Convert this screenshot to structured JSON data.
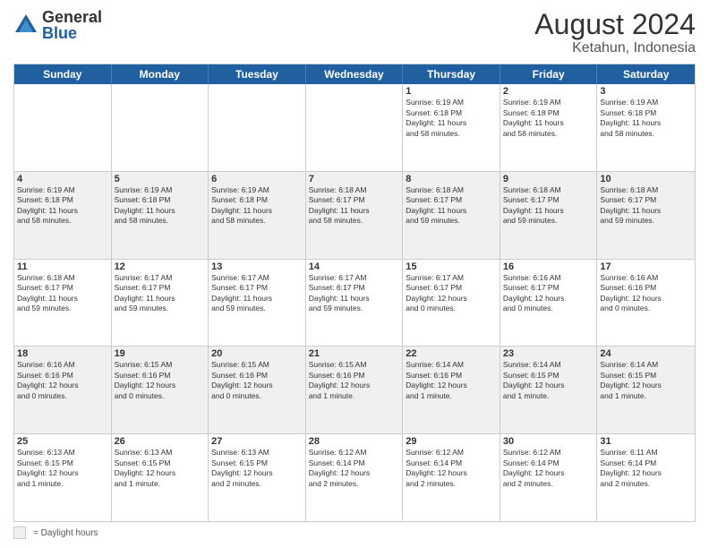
{
  "logo": {
    "general": "General",
    "blue": "Blue"
  },
  "title": "August 2024",
  "subtitle": "Ketahun, Indonesia",
  "days": [
    "Sunday",
    "Monday",
    "Tuesday",
    "Wednesday",
    "Thursday",
    "Friday",
    "Saturday"
  ],
  "legend": {
    "box_label": "= Daylight hours"
  },
  "weeks": [
    [
      {
        "num": "",
        "info": "",
        "empty": true
      },
      {
        "num": "",
        "info": "",
        "empty": true
      },
      {
        "num": "",
        "info": "",
        "empty": true
      },
      {
        "num": "",
        "info": "",
        "empty": true
      },
      {
        "num": "1",
        "info": "Sunrise: 6:19 AM\nSunset: 6:18 PM\nDaylight: 11 hours\nand 58 minutes."
      },
      {
        "num": "2",
        "info": "Sunrise: 6:19 AM\nSunset: 6:18 PM\nDaylight: 11 hours\nand 58 minutes."
      },
      {
        "num": "3",
        "info": "Sunrise: 6:19 AM\nSunset: 6:18 PM\nDaylight: 11 hours\nand 58 minutes."
      }
    ],
    [
      {
        "num": "4",
        "info": "Sunrise: 6:19 AM\nSunset: 6:18 PM\nDaylight: 11 hours\nand 58 minutes."
      },
      {
        "num": "5",
        "info": "Sunrise: 6:19 AM\nSunset: 6:18 PM\nDaylight: 11 hours\nand 58 minutes."
      },
      {
        "num": "6",
        "info": "Sunrise: 6:19 AM\nSunset: 6:18 PM\nDaylight: 11 hours\nand 58 minutes."
      },
      {
        "num": "7",
        "info": "Sunrise: 6:18 AM\nSunset: 6:17 PM\nDaylight: 11 hours\nand 58 minutes."
      },
      {
        "num": "8",
        "info": "Sunrise: 6:18 AM\nSunset: 6:17 PM\nDaylight: 11 hours\nand 59 minutes."
      },
      {
        "num": "9",
        "info": "Sunrise: 6:18 AM\nSunset: 6:17 PM\nDaylight: 11 hours\nand 59 minutes."
      },
      {
        "num": "10",
        "info": "Sunrise: 6:18 AM\nSunset: 6:17 PM\nDaylight: 11 hours\nand 59 minutes."
      }
    ],
    [
      {
        "num": "11",
        "info": "Sunrise: 6:18 AM\nSunset: 6:17 PM\nDaylight: 11 hours\nand 59 minutes."
      },
      {
        "num": "12",
        "info": "Sunrise: 6:17 AM\nSunset: 6:17 PM\nDaylight: 11 hours\nand 59 minutes."
      },
      {
        "num": "13",
        "info": "Sunrise: 6:17 AM\nSunset: 6:17 PM\nDaylight: 11 hours\nand 59 minutes."
      },
      {
        "num": "14",
        "info": "Sunrise: 6:17 AM\nSunset: 6:17 PM\nDaylight: 11 hours\nand 59 minutes."
      },
      {
        "num": "15",
        "info": "Sunrise: 6:17 AM\nSunset: 6:17 PM\nDaylight: 12 hours\nand 0 minutes."
      },
      {
        "num": "16",
        "info": "Sunrise: 6:16 AM\nSunset: 6:17 PM\nDaylight: 12 hours\nand 0 minutes."
      },
      {
        "num": "17",
        "info": "Sunrise: 6:16 AM\nSunset: 6:16 PM\nDaylight: 12 hours\nand 0 minutes."
      }
    ],
    [
      {
        "num": "18",
        "info": "Sunrise: 6:16 AM\nSunset: 6:16 PM\nDaylight: 12 hours\nand 0 minutes."
      },
      {
        "num": "19",
        "info": "Sunrise: 6:15 AM\nSunset: 6:16 PM\nDaylight: 12 hours\nand 0 minutes."
      },
      {
        "num": "20",
        "info": "Sunrise: 6:15 AM\nSunset: 6:16 PM\nDaylight: 12 hours\nand 0 minutes."
      },
      {
        "num": "21",
        "info": "Sunrise: 6:15 AM\nSunset: 6:16 PM\nDaylight: 12 hours\nand 1 minute."
      },
      {
        "num": "22",
        "info": "Sunrise: 6:14 AM\nSunset: 6:16 PM\nDaylight: 12 hours\nand 1 minute."
      },
      {
        "num": "23",
        "info": "Sunrise: 6:14 AM\nSunset: 6:15 PM\nDaylight: 12 hours\nand 1 minute."
      },
      {
        "num": "24",
        "info": "Sunrise: 6:14 AM\nSunset: 6:15 PM\nDaylight: 12 hours\nand 1 minute."
      }
    ],
    [
      {
        "num": "25",
        "info": "Sunrise: 6:13 AM\nSunset: 6:15 PM\nDaylight: 12 hours\nand 1 minute."
      },
      {
        "num": "26",
        "info": "Sunrise: 6:13 AM\nSunset: 6:15 PM\nDaylight: 12 hours\nand 1 minute."
      },
      {
        "num": "27",
        "info": "Sunrise: 6:13 AM\nSunset: 6:15 PM\nDaylight: 12 hours\nand 2 minutes."
      },
      {
        "num": "28",
        "info": "Sunrise: 6:12 AM\nSunset: 6:14 PM\nDaylight: 12 hours\nand 2 minutes."
      },
      {
        "num": "29",
        "info": "Sunrise: 6:12 AM\nSunset: 6:14 PM\nDaylight: 12 hours\nand 2 minutes."
      },
      {
        "num": "30",
        "info": "Sunrise: 6:12 AM\nSunset: 6:14 PM\nDaylight: 12 hours\nand 2 minutes."
      },
      {
        "num": "31",
        "info": "Sunrise: 6:11 AM\nSunset: 6:14 PM\nDaylight: 12 hours\nand 2 minutes."
      }
    ]
  ]
}
